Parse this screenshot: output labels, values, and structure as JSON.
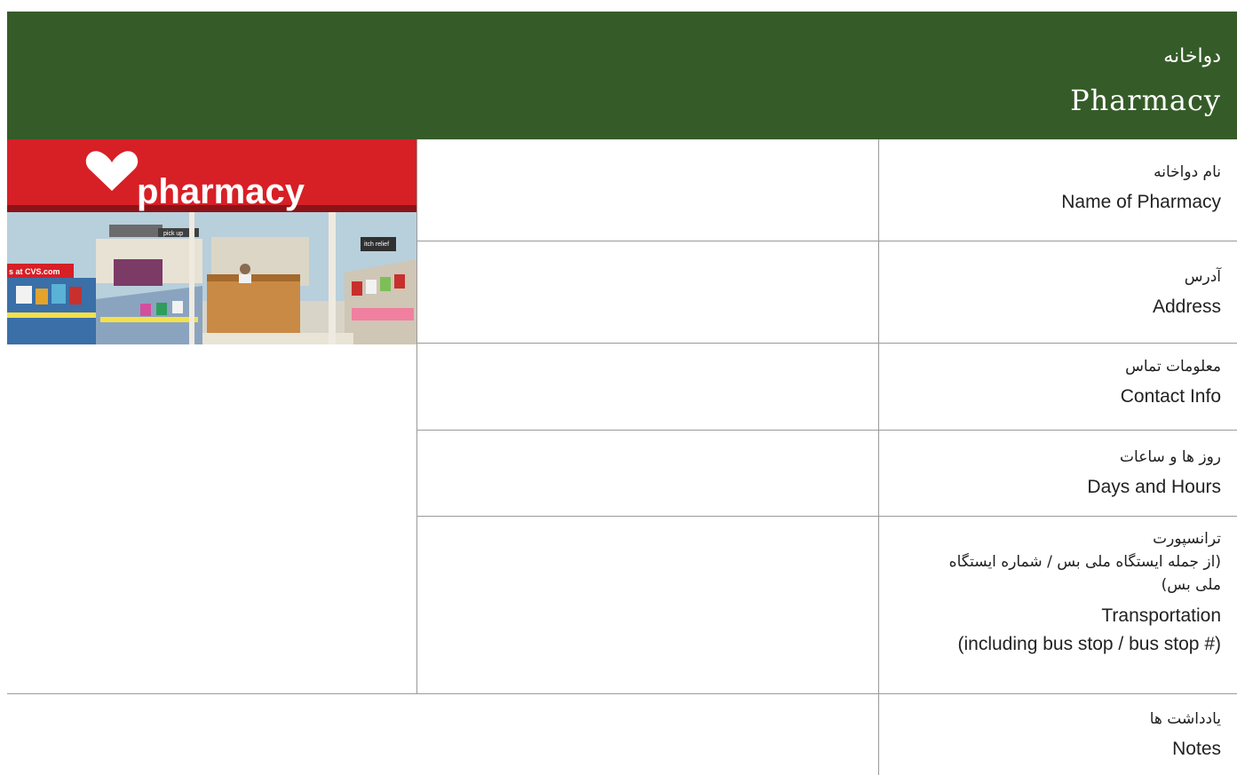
{
  "header": {
    "title_fa": "دواخانه",
    "title_en": "Pharmacy",
    "background": "#355c28"
  },
  "photo": {
    "sign_text": "pharmacy",
    "store_text": "s at CVS.com",
    "counter_sign": "pick up",
    "aisle_sign": "itch relief"
  },
  "rows": [
    {
      "label_fa": "نام دواخانه",
      "label_en": "Name of Pharmacy",
      "value": ""
    },
    {
      "label_fa": "آدرس",
      "label_en": "Address",
      "value": ""
    },
    {
      "label_fa": "معلومات تماس",
      "label_en": "Contact Info",
      "value": ""
    },
    {
      "label_fa": "روز ها و ساعات",
      "label_en": "Days and Hours",
      "value": ""
    },
    {
      "label_fa_1": "ترانسپورت",
      "label_fa_2": "(از جمله ایستگاه ملی بس / شماره ایستگاه ملی بس)",
      "label_en_1": "Transportation",
      "label_en_2": "(including bus stop / bus stop #)",
      "value": ""
    },
    {
      "label_fa": "یادداشت ها",
      "label_en": "Notes",
      "value": ""
    }
  ],
  "colors": {
    "header_bg": "#355c28",
    "grid_line": "#9a9a9a",
    "sign_red": "#d71f26"
  }
}
